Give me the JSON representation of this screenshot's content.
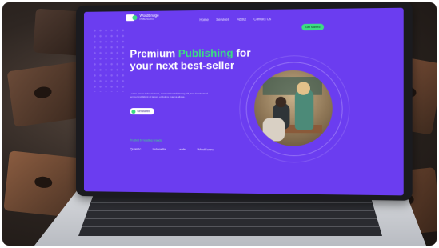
{
  "site": {
    "logo_text": "WordBridge",
    "logo_sub": "PUBLISHING",
    "nav": [
      "Home",
      "Services",
      "About",
      "Contact Us"
    ],
    "cta_label": "Get started",
    "headline_pre": "Premium ",
    "headline_accent": "Publishing",
    "headline_rest": "for your next best-seller",
    "paragraph": "Lorem ipsum dolor sit amet, consectetur adipiscing elit, sed do eiusmod tempor incididunt ut labore et dolore magna aliqua.",
    "start_label": "Get started",
    "trusted_label": "Trusted by leading brands",
    "brands": [
      "Quantic",
      "Indonetta",
      "Leafs",
      "WindScrew"
    ]
  },
  "colors": {
    "page_bg": "#6b3df0",
    "accent": "#3ddc84"
  }
}
